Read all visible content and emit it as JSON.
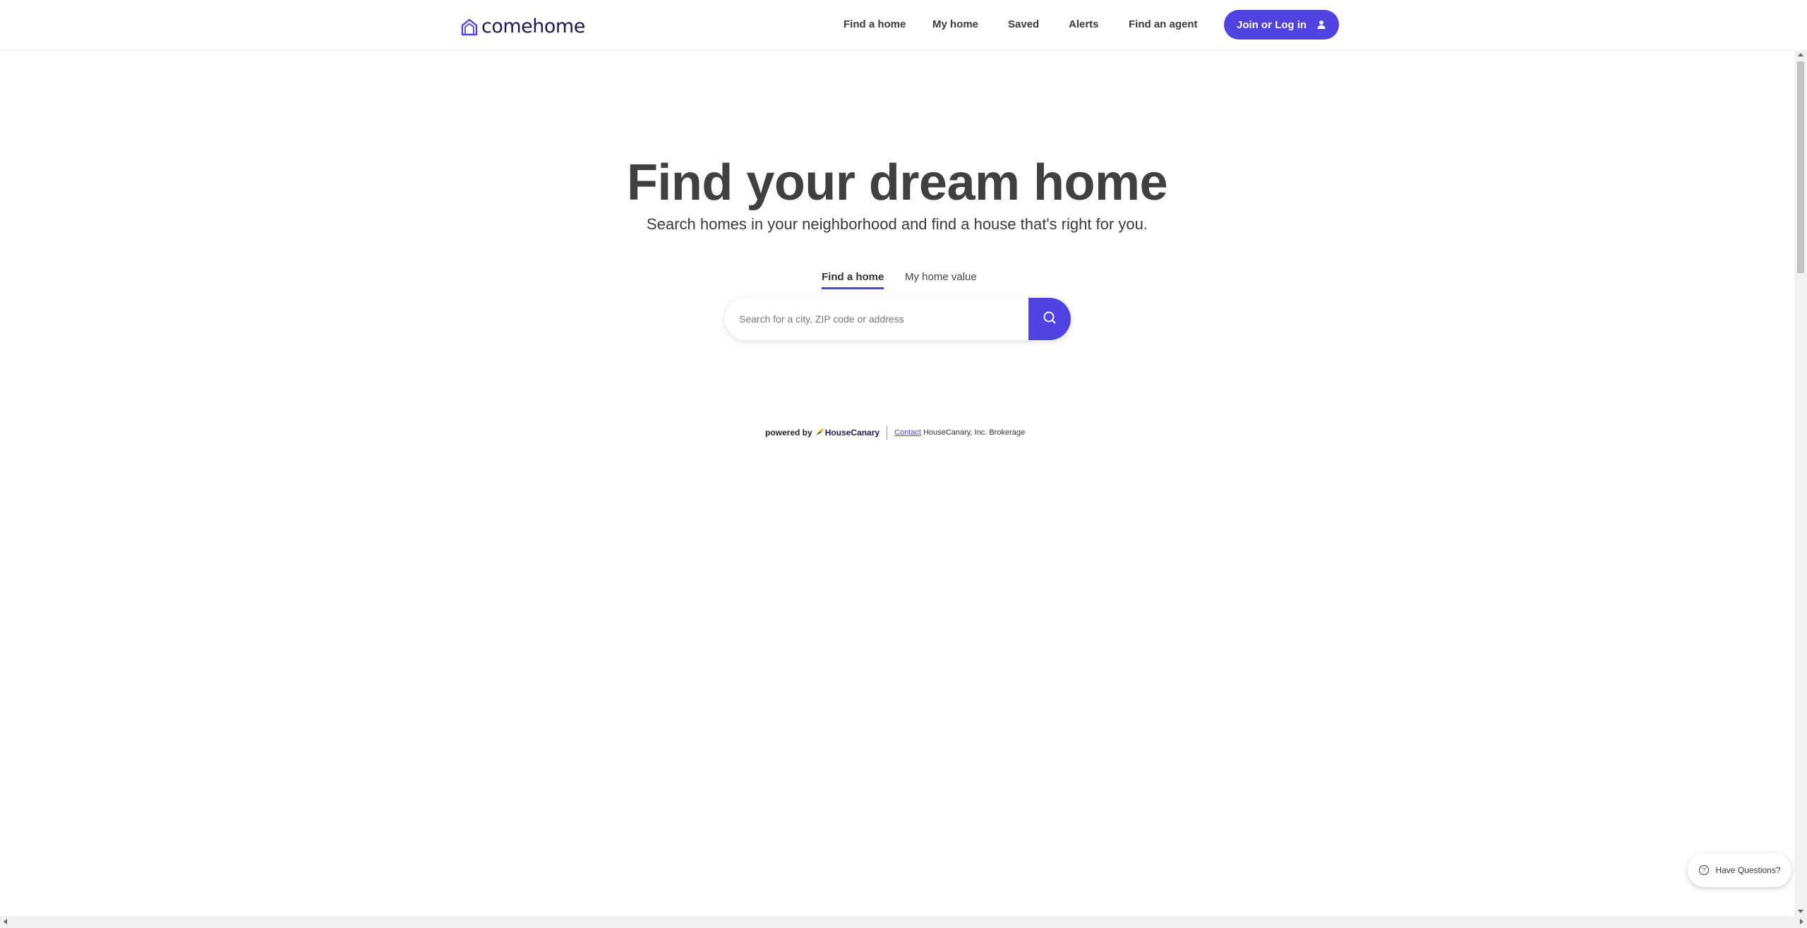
{
  "header": {
    "logo_text": "comehome",
    "nav": [
      "Find a home",
      "My home",
      "Saved",
      "Alerts",
      "Find an agent"
    ],
    "join_label": "Join or Log in"
  },
  "hero": {
    "title": "Find your dream home",
    "subtitle": "Search homes in your neighborhood and find a house that's right for you.",
    "tabs": [
      "Find a home",
      "My home value"
    ],
    "active_tab": "Find a home",
    "search_placeholder": "Search for a city, ZIP code or address",
    "search_value": ""
  },
  "footer": {
    "powered_by": "powered by",
    "brand": "HouseCanary",
    "contact_label": "Contact",
    "brokerage": "HouseCanary, Inc. Brokerage"
  },
  "help": {
    "label": "Have Questions?"
  },
  "colors": {
    "accent": "#4f44e1",
    "text": "#404040"
  }
}
